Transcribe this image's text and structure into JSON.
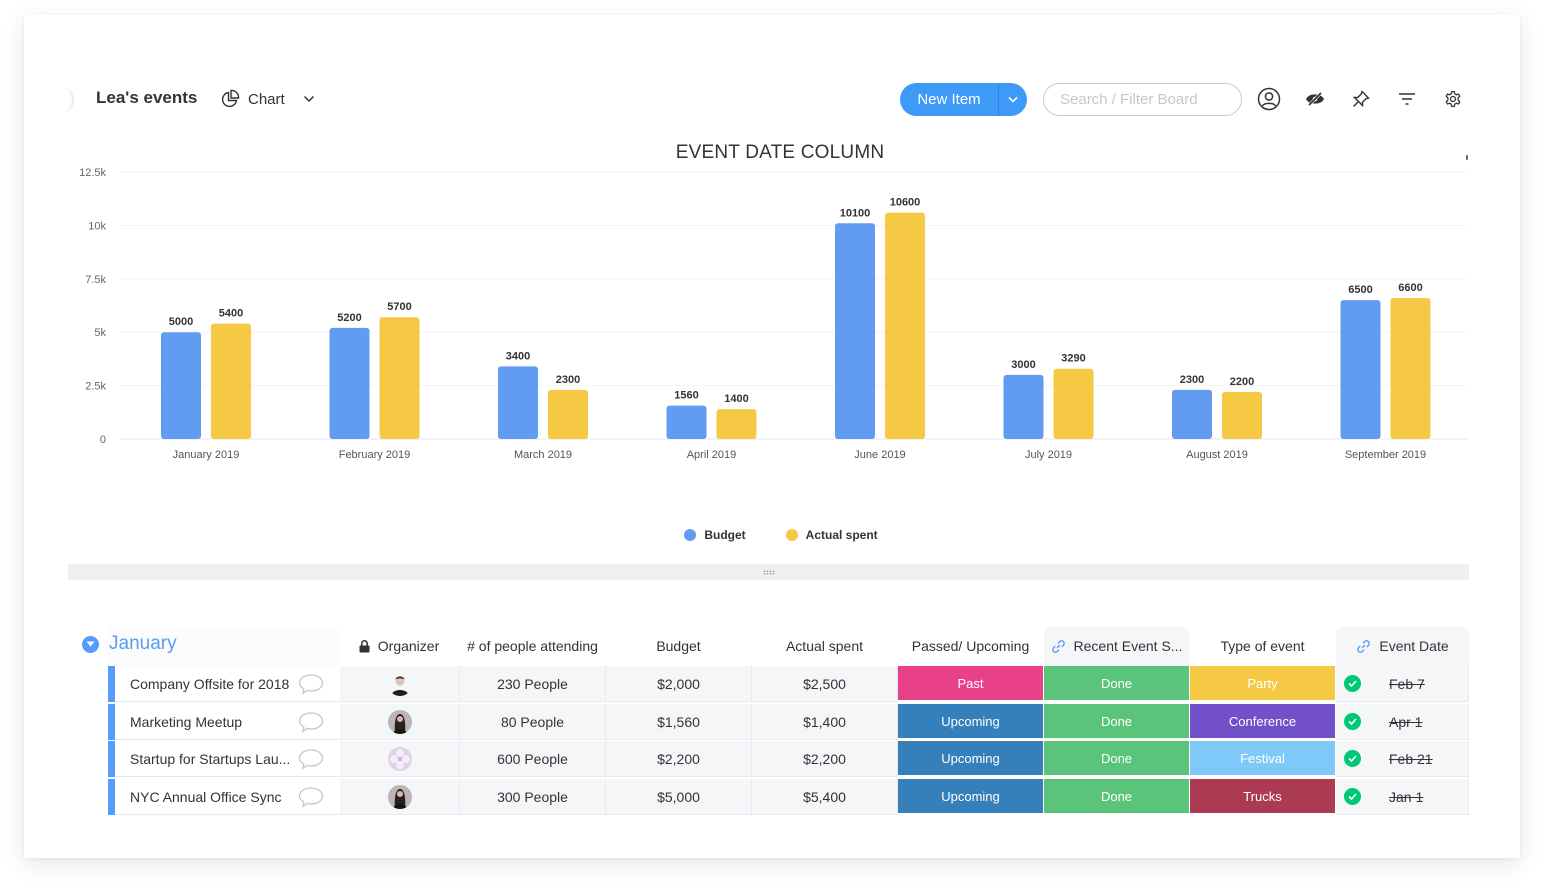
{
  "header": {
    "board_title": "Lea's events",
    "view_label": "Chart",
    "new_item_label": "New Item",
    "search_placeholder": "Search / Filter Board",
    "icons": [
      "person-icon",
      "eye-off-icon",
      "pin-icon",
      "filter-icon",
      "gear-icon"
    ]
  },
  "colors": {
    "budget": "#619bf2",
    "actual": "#f6c944",
    "primary": "#3d9af7",
    "group": "#579bfc",
    "done_check": "#3ebf70"
  },
  "chart_data": {
    "type": "bar",
    "title": "EVENT DATE COLUMN",
    "xlabel": "",
    "ylabel": "",
    "ylim": [
      0,
      12500
    ],
    "yticks": [
      0,
      2500,
      5000,
      7500,
      10000,
      12500
    ],
    "ytick_labels": [
      "0",
      "2.5k",
      "5k",
      "7.5k",
      "10k",
      "12.5k"
    ],
    "grid": true,
    "legend_position": "bottom-center",
    "categories": [
      "January 2019",
      "February 2019",
      "March 2019",
      "April 2019",
      "June 2019",
      "July 2019",
      "August 2019",
      "September 2019"
    ],
    "series": [
      {
        "name": "Budget",
        "color": "#619bf2",
        "values": [
          5000,
          5200,
          3400,
          1560,
          10100,
          3000,
          2300,
          6500
        ]
      },
      {
        "name": "Actual spent",
        "color": "#f6c944",
        "values": [
          5400,
          5700,
          2300,
          1400,
          10600,
          3290,
          2200,
          6600
        ]
      }
    ]
  },
  "table": {
    "group_title": "January",
    "columns": {
      "organizer": "Organizer",
      "people": "# of people attending",
      "budget": "Budget",
      "actual": "Actual spent",
      "passed": "Passed/ Upcoming",
      "recent": "Recent Event S...",
      "type": "Type of event",
      "date": "Event Date"
    },
    "rows": [
      {
        "name": "Company Offsite for 2018",
        "organizer": "man-avatar",
        "people": "230 People",
        "budget": "$2,000",
        "actual": "$2,500",
        "passed": "Past",
        "passed_color": "#e8418a",
        "recent": "Done",
        "recent_color": "#5ac57a",
        "type": "Party",
        "type_color": "#f6c944",
        "date": "Feb 7"
      },
      {
        "name": "Marketing Meetup",
        "organizer": "woman-avatar",
        "people": "80 People",
        "budget": "$1,560",
        "actual": "$1,400",
        "passed": "Upcoming",
        "passed_color": "#3580bb",
        "recent": "Done",
        "recent_color": "#5ac57a",
        "type": "Conference",
        "type_color": "#7150c9",
        "date": "Apr 1"
      },
      {
        "name": "Startup for Startups Lau...",
        "organizer": "flower-avatar",
        "people": "600 People",
        "budget": "$2,200",
        "actual": "$2,200",
        "passed": "Upcoming",
        "passed_color": "#3580bb",
        "recent": "Done",
        "recent_color": "#5ac57a",
        "type": "Festival",
        "type_color": "#7ec9f8",
        "date": "Feb 21"
      },
      {
        "name": "NYC Annual Office Sync",
        "organizer": "woman-avatar",
        "people": "300 People",
        "budget": "$5,000",
        "actual": "$5,400",
        "passed": "Upcoming",
        "passed_color": "#3580bb",
        "recent": "Done",
        "recent_color": "#5ac57a",
        "type": "Trucks",
        "type_color": "#aa3b52",
        "date": "Jan 1"
      }
    ]
  }
}
